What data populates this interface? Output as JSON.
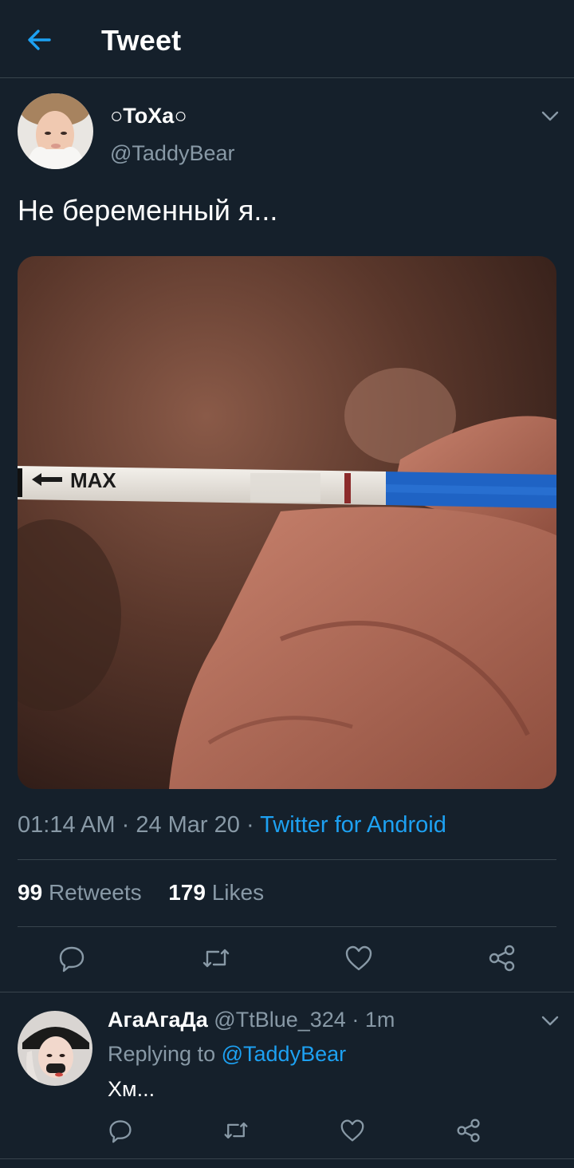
{
  "header": {
    "title": "Tweet"
  },
  "tweet": {
    "display_name": "○ToXa○",
    "handle": "@TaddyBear",
    "text": "Не беременный я...",
    "media_text": "MAX",
    "time": "01:14 AM",
    "date": "24 Mar 20",
    "source": "Twitter for Android",
    "retweets": "99",
    "retweets_label": "Retweets",
    "likes": "179",
    "likes_label": "Likes"
  },
  "reply": {
    "display_name": "АгаАгаДа",
    "handle": "@TtBlue_324",
    "time": "1m",
    "replying_label": "Replying to",
    "replying_to": "@TaddyBear",
    "text": "Хм..."
  },
  "colors": {
    "background": "#15202b",
    "divider": "#38444d",
    "secondary_text": "#8899a6",
    "accent": "#1da1f2"
  },
  "icons": {
    "back": "arrow-left-icon",
    "more": "chevron-down-icon",
    "reply": "comment-icon",
    "retweet": "retweet-icon",
    "like": "heart-icon",
    "share": "share-icon"
  }
}
